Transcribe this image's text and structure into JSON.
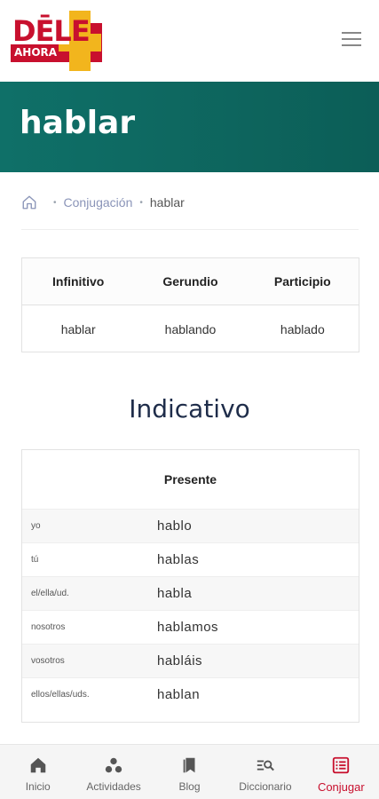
{
  "brand": {
    "logo_top": "DĒLE",
    "logo_bottom": "AHORA"
  },
  "hero": {
    "title": "hablar"
  },
  "breadcrumb": {
    "link": "Conjugación",
    "current": "hablar"
  },
  "forms": {
    "headers": [
      "Infinitivo",
      "Gerundio",
      "Participio"
    ],
    "values": [
      "hablar",
      "hablando",
      "hablado"
    ]
  },
  "indicativo": {
    "title": "Indicativo",
    "tense": "Presente",
    "rows": [
      {
        "pronoun": "yo",
        "form": "hablo"
      },
      {
        "pronoun": "tú",
        "form": "hablas"
      },
      {
        "pronoun": "el/ella/ud.",
        "form": "habla"
      },
      {
        "pronoun": "nosotros",
        "form": "hablamos"
      },
      {
        "pronoun": "vosotros",
        "form": "habláis"
      },
      {
        "pronoun": "ellos/ellas/uds.",
        "form": "hablan"
      }
    ]
  },
  "nav": {
    "items": [
      {
        "label": "Inicio",
        "icon": "home-icon"
      },
      {
        "label": "Actividades",
        "icon": "activities-icon"
      },
      {
        "label": "Blog",
        "icon": "bookmark-icon"
      },
      {
        "label": "Diccionario",
        "icon": "dictionary-search-icon"
      },
      {
        "label": "Conjugar",
        "icon": "list-icon"
      }
    ],
    "active": "Conjugar",
    "active_color": "#c8102e"
  },
  "colors": {
    "hero": "#0f7068",
    "brand_red": "#c8102e",
    "brand_yellow": "#f2b51d"
  }
}
